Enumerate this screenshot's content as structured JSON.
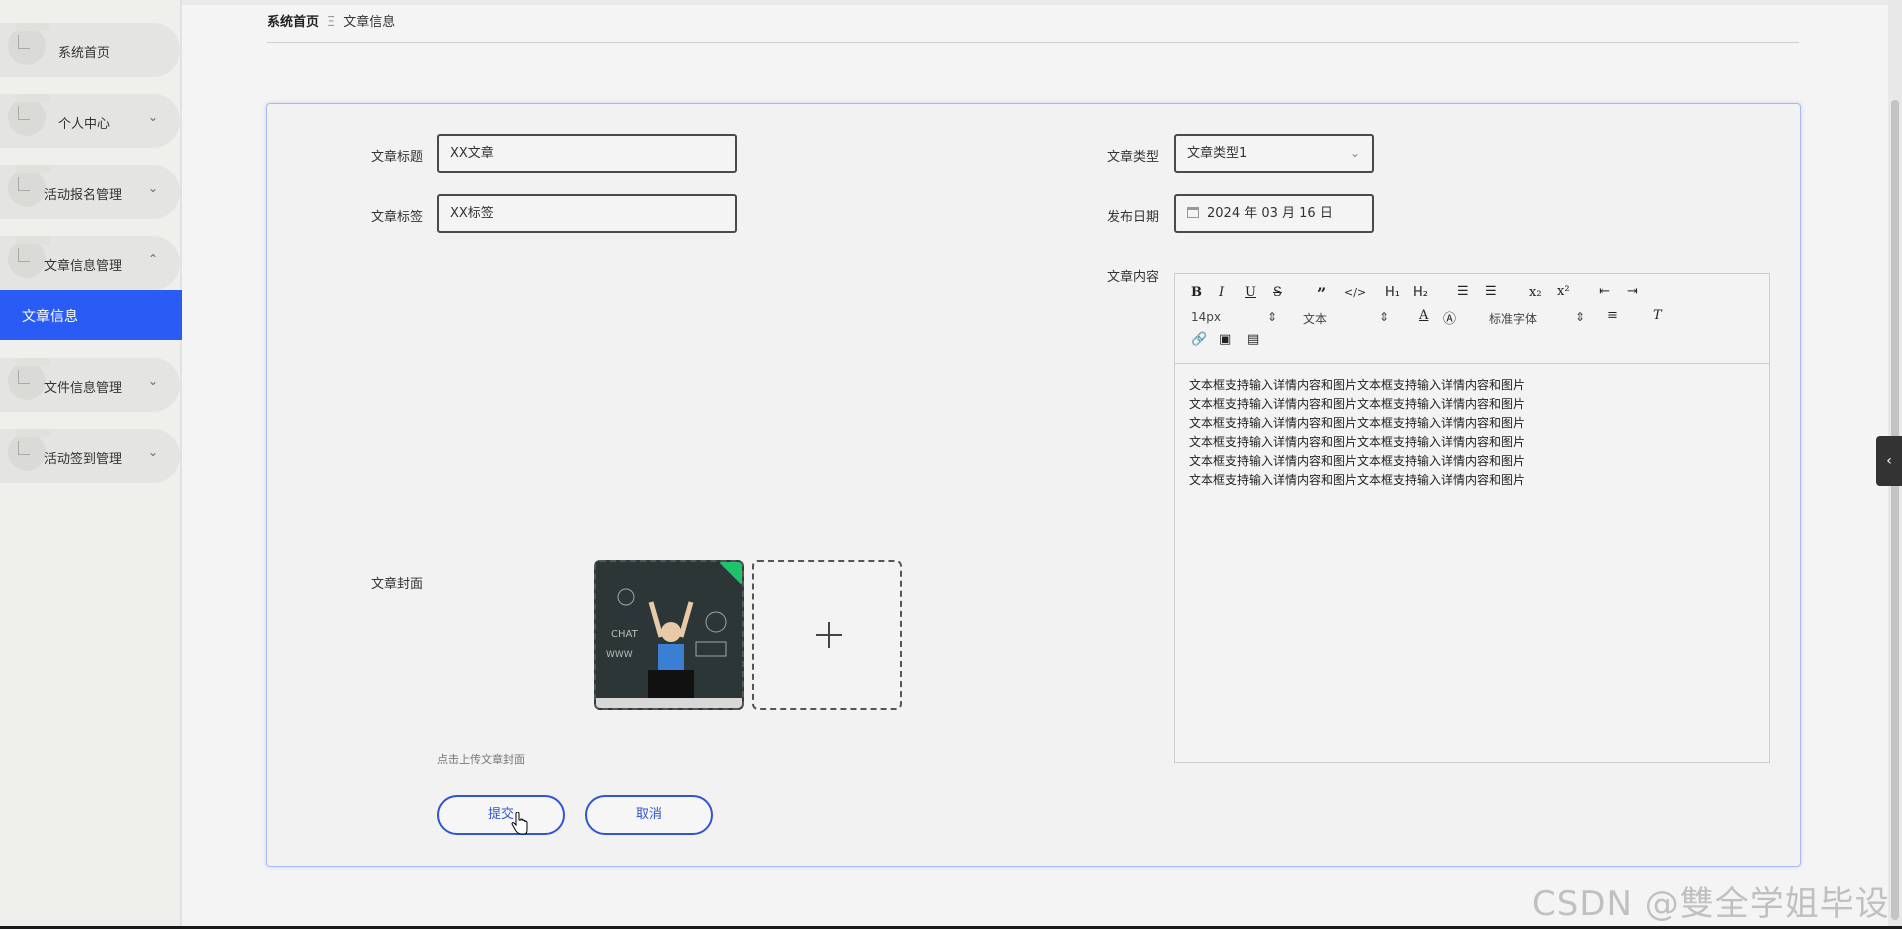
{
  "sidebar": {
    "items": [
      {
        "label": "系统首页",
        "chevron": ""
      },
      {
        "label": "个人中心",
        "chevron": "⌄"
      },
      {
        "label": "活动报名管理",
        "chevron": "⌄"
      },
      {
        "label": "文章信息管理",
        "chevron": "⌃"
      },
      {
        "label": "文件信息管理",
        "chevron": "⌄"
      },
      {
        "label": "活动签到管理",
        "chevron": "⌄"
      }
    ],
    "active_sub": "文章信息"
  },
  "breadcrumb": {
    "home": "系统首页",
    "separator": "Ξ",
    "current": "文章信息"
  },
  "form": {
    "title_label": "文章标题",
    "title_value": "XX文章",
    "tag_label": "文章标签",
    "tag_value": "XX标签",
    "type_label": "文章类型",
    "type_value": "文章类型1",
    "date_label": "发布日期",
    "date_value": "2024 年 03 月 16 日",
    "cover_label": "文章封面",
    "cover_hint": "点击上传文章封面",
    "content_label": "文章内容",
    "submit_label": "提交",
    "cancel_label": "取消"
  },
  "editor": {
    "font_size": "14px",
    "block_type": "文本",
    "font_family": "标准字体",
    "lines": [
      "文本框支持输入详情内容和图片文本框支持输入详情内容和图片",
      "文本框支持输入详情内容和图片文本框支持输入详情内容和图片",
      "文本框支持输入详情内容和图片文本框支持输入详情内容和图片",
      "文本框支持输入详情内容和图片文本框支持输入详情内容和图片",
      "文本框支持输入详情内容和图片文本框支持输入详情内容和图片",
      "文本框支持输入详情内容和图片文本框支持输入详情内容和图片"
    ]
  },
  "watermark": "CSDN @雙全学姐毕设",
  "colors": {
    "accent": "#2a5cf5",
    "button_border": "#2f55d4",
    "card_border": "#a8b8f4",
    "upload_tag": "#1ec26a"
  }
}
